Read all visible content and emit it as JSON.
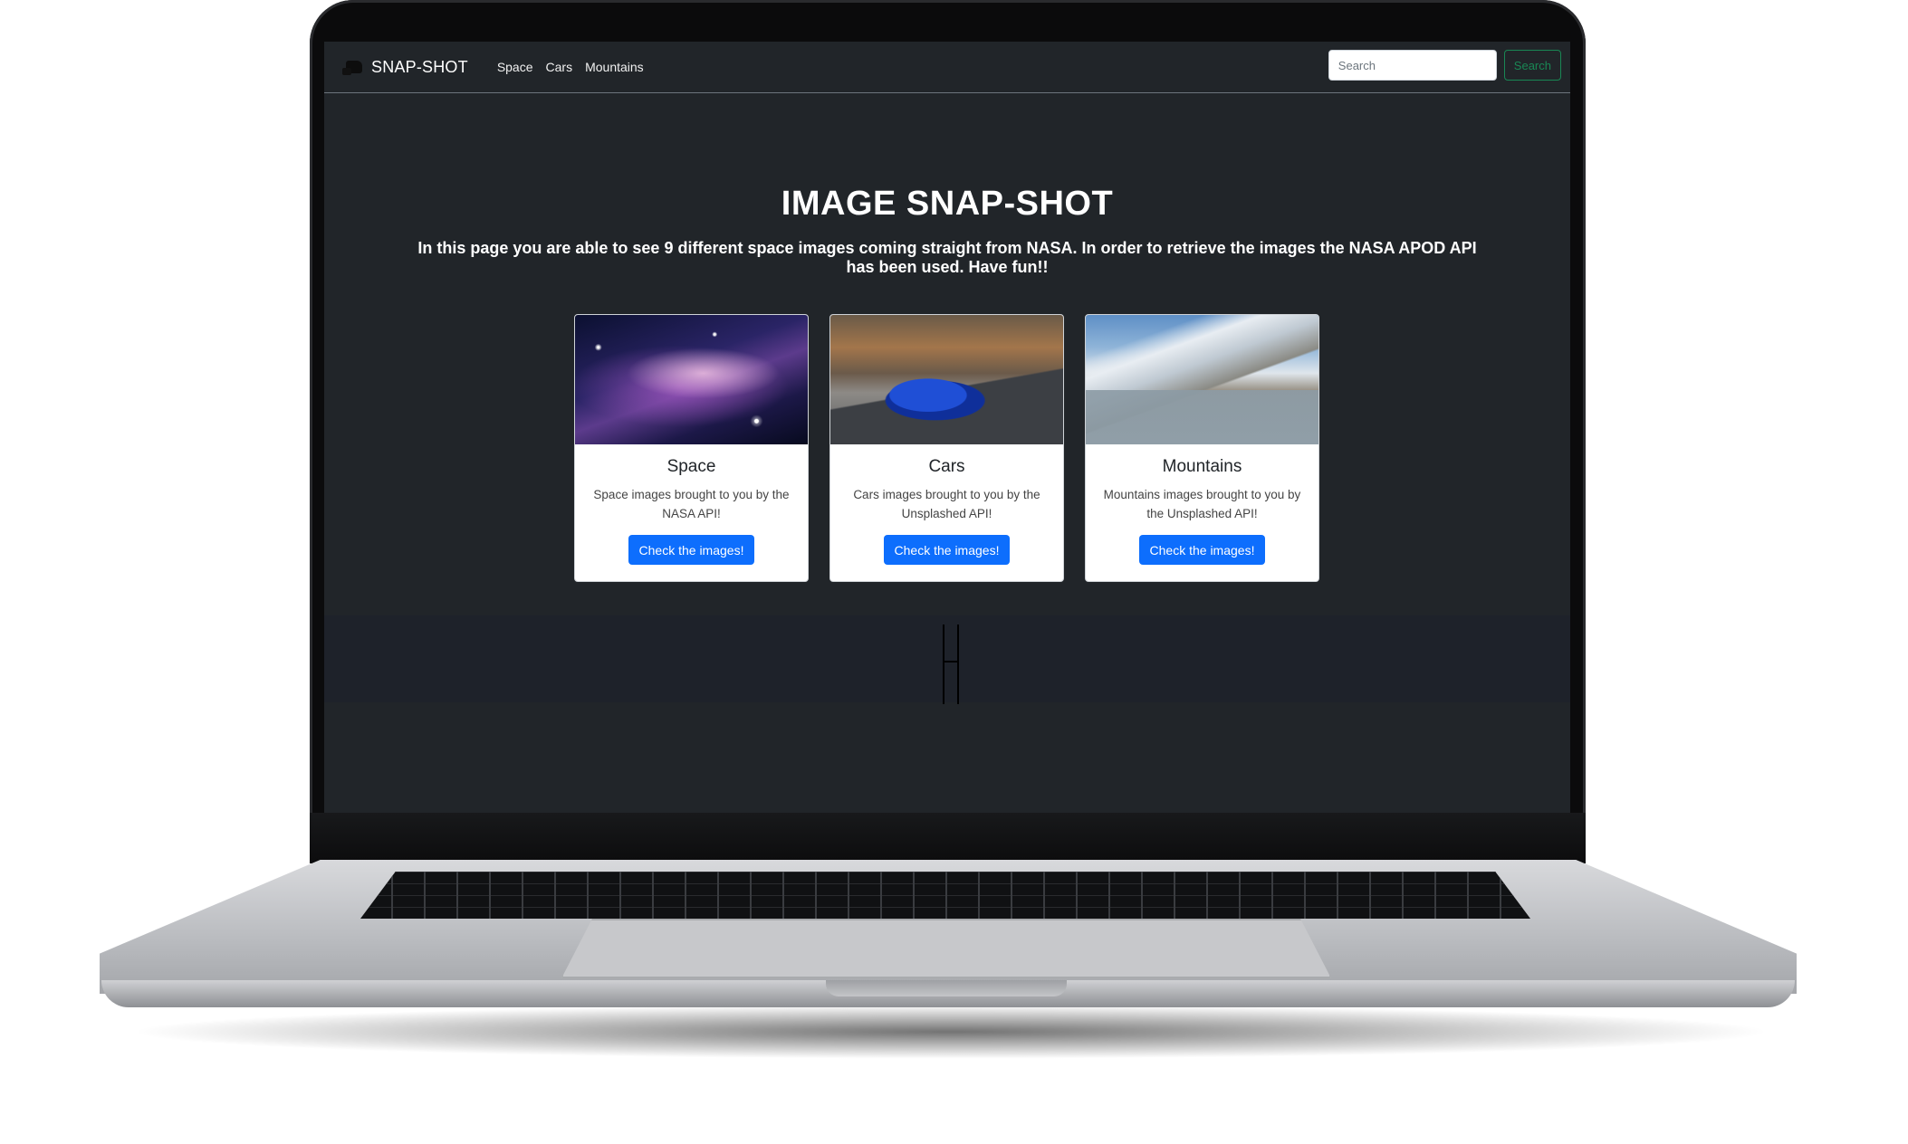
{
  "navbar": {
    "brand": "SNAP-SHOT",
    "links": [
      "Space",
      "Cars",
      "Mountains"
    ],
    "search": {
      "placeholder": "Search",
      "button_label": "Search"
    }
  },
  "hero": {
    "title": "IMAGE SNAP-SHOT",
    "subtitle": "In this page you are able to see 9 different space images coming straight from NASA. In order to retrieve the images the NASA APOD API has been used. Have fun!!"
  },
  "cards": [
    {
      "title": "Space",
      "text": "Space images brought to you by the NASA API!",
      "button_label": "Check the images!"
    },
    {
      "title": "Cars",
      "text": "Cars images brought to you by the Unsplashed API!",
      "button_label": "Check the images!"
    },
    {
      "title": "Mountains",
      "text": "Mountains images brought to you by the Unsplashed API!",
      "button_label": "Check the images!"
    }
  ],
  "colors": {
    "page_background": "#212529",
    "primary_button": "#0d6efd",
    "search_button": "#198754"
  },
  "icons": {
    "brand": "camera-operator-icon"
  }
}
